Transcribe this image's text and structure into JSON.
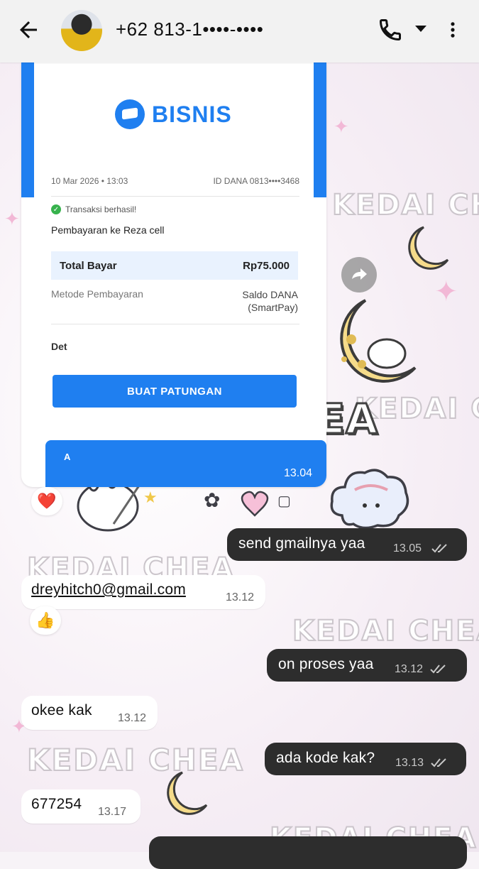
{
  "header": {
    "contact_name": "+62 813-1••••-••••"
  },
  "receipt": {
    "brand": "BISNIS",
    "date": "10 Mar 2026 • 13:03",
    "dana_id": "ID DANA 0813••••3468",
    "status": "Transaksi berhasil!",
    "title": "Pembayaran ke Reza cell",
    "total_label": "Total Bayar",
    "total_value": "Rp75.000",
    "method_label": "Metode Pembayaran",
    "method_value_1": "Saldo DANA",
    "method_value_2": "(SmartPay)",
    "detail_label": "Det",
    "button_label": "BUAT PATUNGAN",
    "banner_text": "A",
    "time": "13.04"
  },
  "messages": [
    {
      "dir": "out",
      "text": "send gmailnya yaa",
      "time": "13.05"
    },
    {
      "dir": "in",
      "text": "dreyhitch0@gmail.com",
      "time": "13.12"
    },
    {
      "dir": "out",
      "text": "on proses yaa",
      "time": "13.12"
    },
    {
      "dir": "in",
      "text": "okee kak",
      "time": "13.12"
    },
    {
      "dir": "out",
      "text": "ada kode kak?",
      "time": "13.13"
    },
    {
      "dir": "in",
      "text": "677254",
      "time": "13.17"
    }
  ],
  "reactions": {
    "heart": "❤️",
    "thumbs": "👍"
  },
  "watermark": "KEDAI CHEA",
  "colors": {
    "dana_blue": "#1f7ff0",
    "outgoing_bubble": "#2d2d2d",
    "incoming_bubble": "#ffffff"
  }
}
